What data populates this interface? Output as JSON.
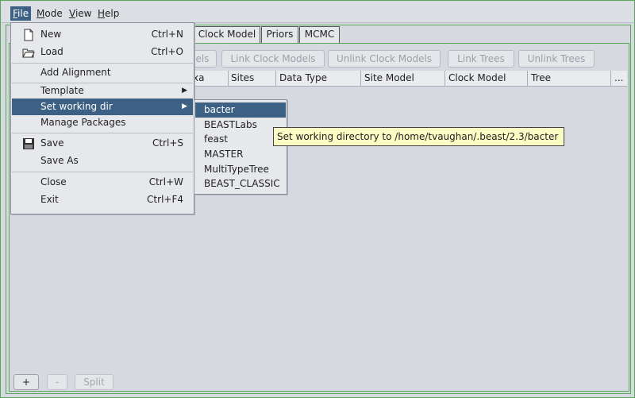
{
  "menubar": {
    "items": [
      {
        "label": "File",
        "mnemonic_first": "F",
        "rest": "ile"
      },
      {
        "label": "Mode",
        "mnemonic_first": "M",
        "rest": "ode"
      },
      {
        "label": "View",
        "mnemonic_first": "V",
        "rest": "iew"
      },
      {
        "label": "Help",
        "mnemonic_first": "H",
        "rest": "elp"
      }
    ]
  },
  "tabs": [
    "Clock Model",
    "Priors",
    "MCMC"
  ],
  "toolbar": {
    "link_site_partial": "els",
    "link_clock": "Link Clock Models",
    "unlink_clock": "Unlink Clock Models",
    "link_trees": "Link Trees",
    "unlink_trees": "Unlink Trees"
  },
  "table": {
    "headers": [
      "xa",
      "Sites",
      "Data Type",
      "Site Model",
      "Clock Model",
      "Tree",
      "..."
    ]
  },
  "bottom": {
    "add": "+",
    "remove": "-",
    "split": "Split"
  },
  "file_menu": {
    "new": {
      "label": "New",
      "accel": "Ctrl+N"
    },
    "load": {
      "label": "Load",
      "accel": "Ctrl+O"
    },
    "add_alignment": {
      "label": "Add Alignment"
    },
    "template": {
      "label": "Template"
    },
    "set_working_dir": {
      "label": "Set working dir"
    },
    "manage_packages": {
      "label": "Manage Packages"
    },
    "save": {
      "label": "Save",
      "accel": "Ctrl+S"
    },
    "save_as": {
      "label": "Save As"
    },
    "close": {
      "label": "Close",
      "accel": "Ctrl+W"
    },
    "exit": {
      "label": "Exit",
      "accel": "Ctrl+F4"
    }
  },
  "submenu": {
    "items": [
      "bacter",
      "BEASTLabs",
      "feast",
      "MASTER",
      "MultiTypeTree",
      "BEAST_CLASSIC"
    ]
  },
  "tooltip": "Set working directory to /home/tvaughan/.beast/2.3/bacter",
  "colors": {
    "accent": "#3d6185",
    "tooltip_bg": "#fbfbc4",
    "frame_green": "#58a858"
  }
}
